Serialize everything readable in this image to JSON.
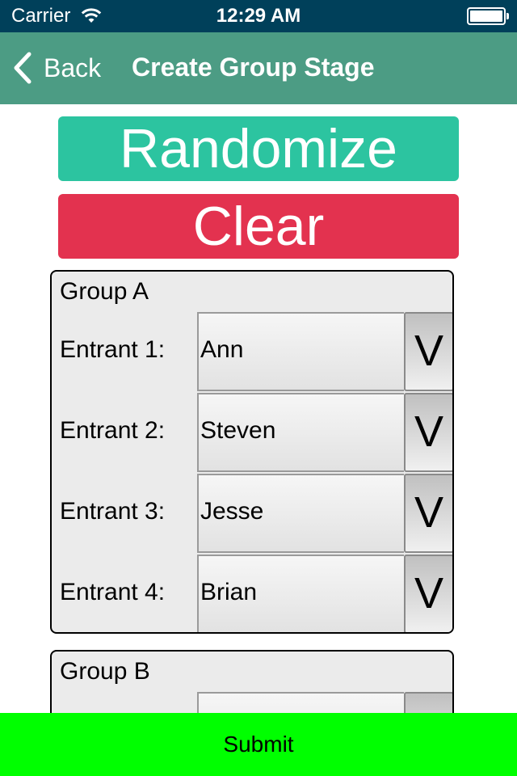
{
  "status_bar": {
    "carrier": "Carrier",
    "time": "12:29 AM"
  },
  "nav": {
    "back_label": "Back",
    "title": "Create Group Stage"
  },
  "actions": {
    "randomize_label": "Randomize",
    "clear_label": "Clear"
  },
  "groups": [
    {
      "title": "Group A",
      "entrants": [
        {
          "label": "Entrant 1:",
          "value": "Ann"
        },
        {
          "label": "Entrant 2:",
          "value": "Steven"
        },
        {
          "label": "Entrant 3:",
          "value": "Jesse"
        },
        {
          "label": "Entrant 4:",
          "value": "Brian"
        }
      ]
    },
    {
      "title": "Group B",
      "entrants": [
        {
          "label": "",
          "value": ""
        }
      ]
    }
  ],
  "dropdown_arrow": "V",
  "submit_label": "Submit",
  "icons": {
    "wifi": "wifi-icon",
    "battery": "battery-icon",
    "back": "chevron-left-icon"
  },
  "colors": {
    "status_bar": "#00405a",
    "nav_bar": "#4c9c84",
    "randomize": "#2cc4a0",
    "clear": "#e3324f",
    "submit": "#00ff00"
  }
}
